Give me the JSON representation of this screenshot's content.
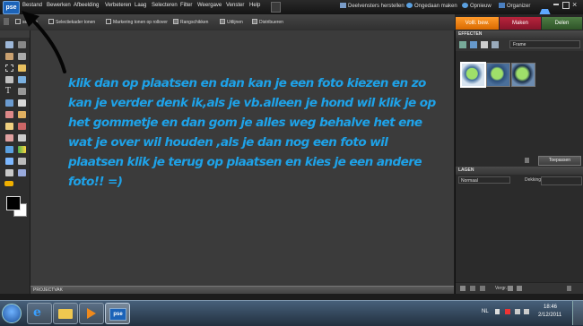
{
  "app": {
    "logo": "pse"
  },
  "menus": [
    "Bestand",
    "Bewerken",
    "Afbeelding",
    "Verbeteren",
    "Laag",
    "Selecteren",
    "Filter",
    "Weergave",
    "Venster",
    "Help"
  ],
  "menu_right": {
    "restore": "Deelvensters herstellen",
    "undo": "Ongedaan maken",
    "redo": "Opnieuw",
    "organizer": "Organizer"
  },
  "options": {
    "sel": "selectie",
    "show_sel": "Selectiekader tonen",
    "rollover": "Markering tonen op rollover",
    "align": "Rangschikken",
    "align2": "Uitlijnen",
    "distribute": "Distribueren"
  },
  "modes": {
    "full": "Volll. bew.",
    "create": "Maken",
    "share": "Delen"
  },
  "effects": {
    "title": "EFFECTEN",
    "dropdown": "Frame",
    "apply": "Toepassen"
  },
  "layers": {
    "title": "LAGEN",
    "blend": "Normaal",
    "opacity_label": "Dekking:",
    "lock_label": "Vergr.:"
  },
  "project": {
    "label": "PROJECTVAK"
  },
  "message": "klik dan op plaatsen en dan kan je een foto kiezen en zo kan je verder denk ik,als je vb.alleen je hond wil klik je op het gommetje en dan gom je alles weg behalve het ene wat je over wil houden ,als je dan nog een foto wil plaatsen klik je terug op plaatsen en kies je een andere foto!! =)",
  "taskbar": {
    "lang": "NL",
    "time": "18:46",
    "date": "2/12/2011"
  }
}
